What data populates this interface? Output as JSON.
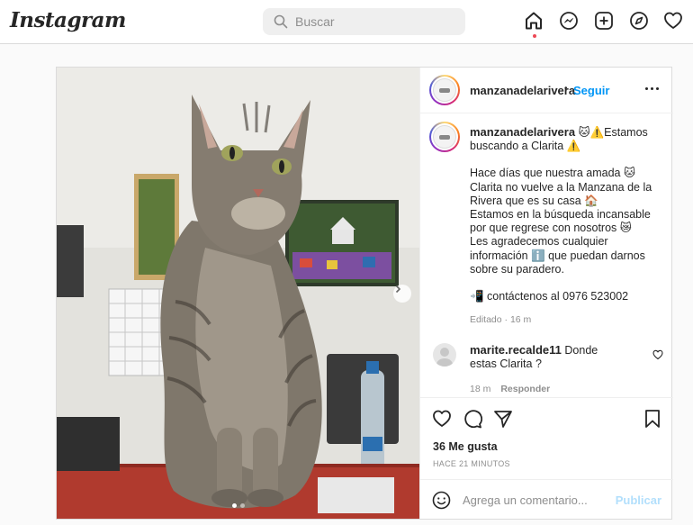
{
  "app": {
    "name": "Instagram"
  },
  "search": {
    "placeholder": "Buscar"
  },
  "nav": {
    "icons": [
      "home-icon",
      "messenger-icon",
      "new-post-icon",
      "explore-icon",
      "activity-heart-icon"
    ],
    "active": "home-icon",
    "notification_color": "#ed4956"
  },
  "post": {
    "author": "manzanadelarivera",
    "follow_separator": "•",
    "follow_label": "Seguir",
    "caption": {
      "author": "manzanadelarivera",
      "first_line": "🐱⚠️Estamos buscando a Clarita ⚠️",
      "body": "Hace días que nuestra amada 🐱Clarita no vuelve a la Manzana de la Rivera que es su casa 🏠\nEstamos en la búsqueda incansable por que regrese con nosotros 😿\nLes agradecemos cualquier información ℹ️ que puedan darnos sobre su paradero.",
      "contact": "📲 contáctenos al 0976 523002",
      "edited": "Editado · 16 m"
    },
    "comment": {
      "author": "marite.recalde11",
      "text": "Donde estas Clarita ?",
      "time": "18 m",
      "reply": "Responder"
    },
    "likes": "36 Me gusta",
    "timestamp": "HACE 21 MINUTOS",
    "add_comment_placeholder": "Agrega un comentario...",
    "publish_label": "Publicar",
    "carousel": {
      "count": 2,
      "active_index": 0
    }
  },
  "colors": {
    "link": "#0095f6",
    "publish_disabled": "#b2dffc",
    "border": "#dbdbdb"
  }
}
